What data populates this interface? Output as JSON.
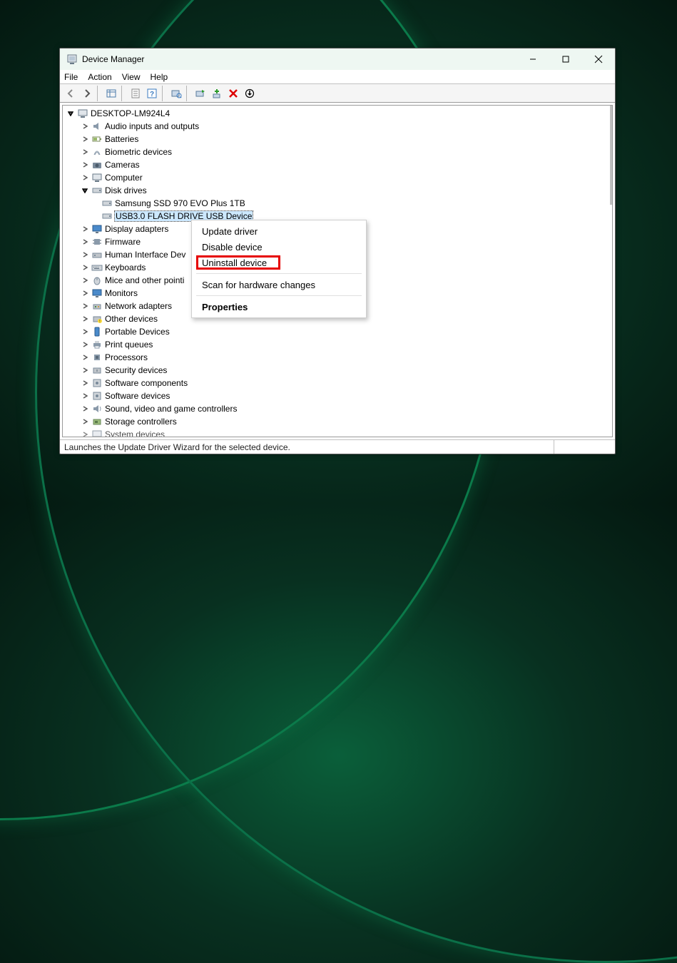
{
  "window": {
    "title": "Device Manager"
  },
  "menubar": {
    "file": "File",
    "action": "Action",
    "view": "View",
    "help": "Help"
  },
  "tree": {
    "root": "DESKTOP-LM924L4",
    "categories": {
      "audio": "Audio inputs and outputs",
      "batteries": "Batteries",
      "biometric": "Biometric devices",
      "cameras": "Cameras",
      "computer": "Computer",
      "disk_drives": "Disk drives",
      "display": "Display adapters",
      "firmware": "Firmware",
      "hid": "Human Interface Dev",
      "keyboards": "Keyboards",
      "mice": "Mice and other pointi",
      "monitors": "Monitors",
      "network": "Network adapters",
      "other": "Other devices",
      "portable": "Portable Devices",
      "print": "Print queues",
      "processors": "Processors",
      "security": "Security devices",
      "softcomp": "Software components",
      "softdev": "Software devices",
      "sound": "Sound, video and game controllers",
      "storage": "Storage controllers",
      "system": "System devices"
    },
    "disk_children": {
      "ssd": "Samsung SSD 970 EVO Plus 1TB",
      "usb": "USB3.0 FLASH DRIVE USB Device"
    }
  },
  "context_menu": {
    "update": "Update driver",
    "disable": "Disable device",
    "uninstall": "Uninstall device",
    "scan": "Scan for hardware changes",
    "properties": "Properties"
  },
  "statusbar": {
    "text": "Launches the Update Driver Wizard for the selected device."
  }
}
